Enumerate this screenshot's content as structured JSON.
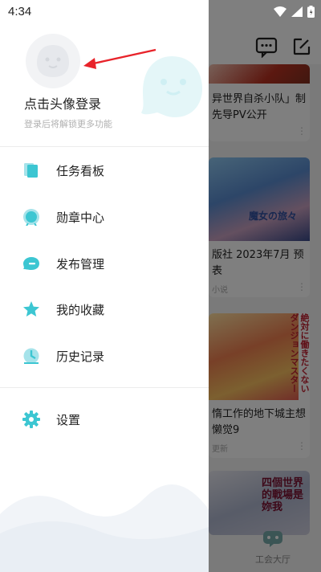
{
  "status_bar": {
    "time": "4:34"
  },
  "drawer": {
    "login_prompt": "点击头像登录",
    "login_subtitle": "登录后将解锁更多功能",
    "menu": [
      {
        "label": "任务看板",
        "icon": "task-board-icon"
      },
      {
        "label": "勋章中心",
        "icon": "medal-icon"
      },
      {
        "label": "发布管理",
        "icon": "publish-icon"
      },
      {
        "label": "我的收藏",
        "icon": "star-icon"
      },
      {
        "label": "历史记录",
        "icon": "history-icon"
      }
    ],
    "settings": {
      "label": "设置",
      "icon": "gear-icon"
    }
  },
  "feed": {
    "cards": [
      {
        "title": "异世界自杀小队」制",
        "title2": "先导PV公开"
      },
      {
        "thumb_text": "魔女の旅々",
        "title": "版社 2023年7月 预",
        "title2": "表",
        "meta": "小说"
      },
      {
        "thumb_text": "絶対に働きたくないダンジョンマスター",
        "title": "惰工作的地下城主想",
        "title2": "懒觉9",
        "meta": "更新"
      },
      {
        "thumb_text": "四個世界的戰場是妳我"
      }
    ],
    "bottom_tab_label": "工会大厅"
  },
  "colors": {
    "accent": "#3cc6d2",
    "arrow": "#e8232a"
  }
}
